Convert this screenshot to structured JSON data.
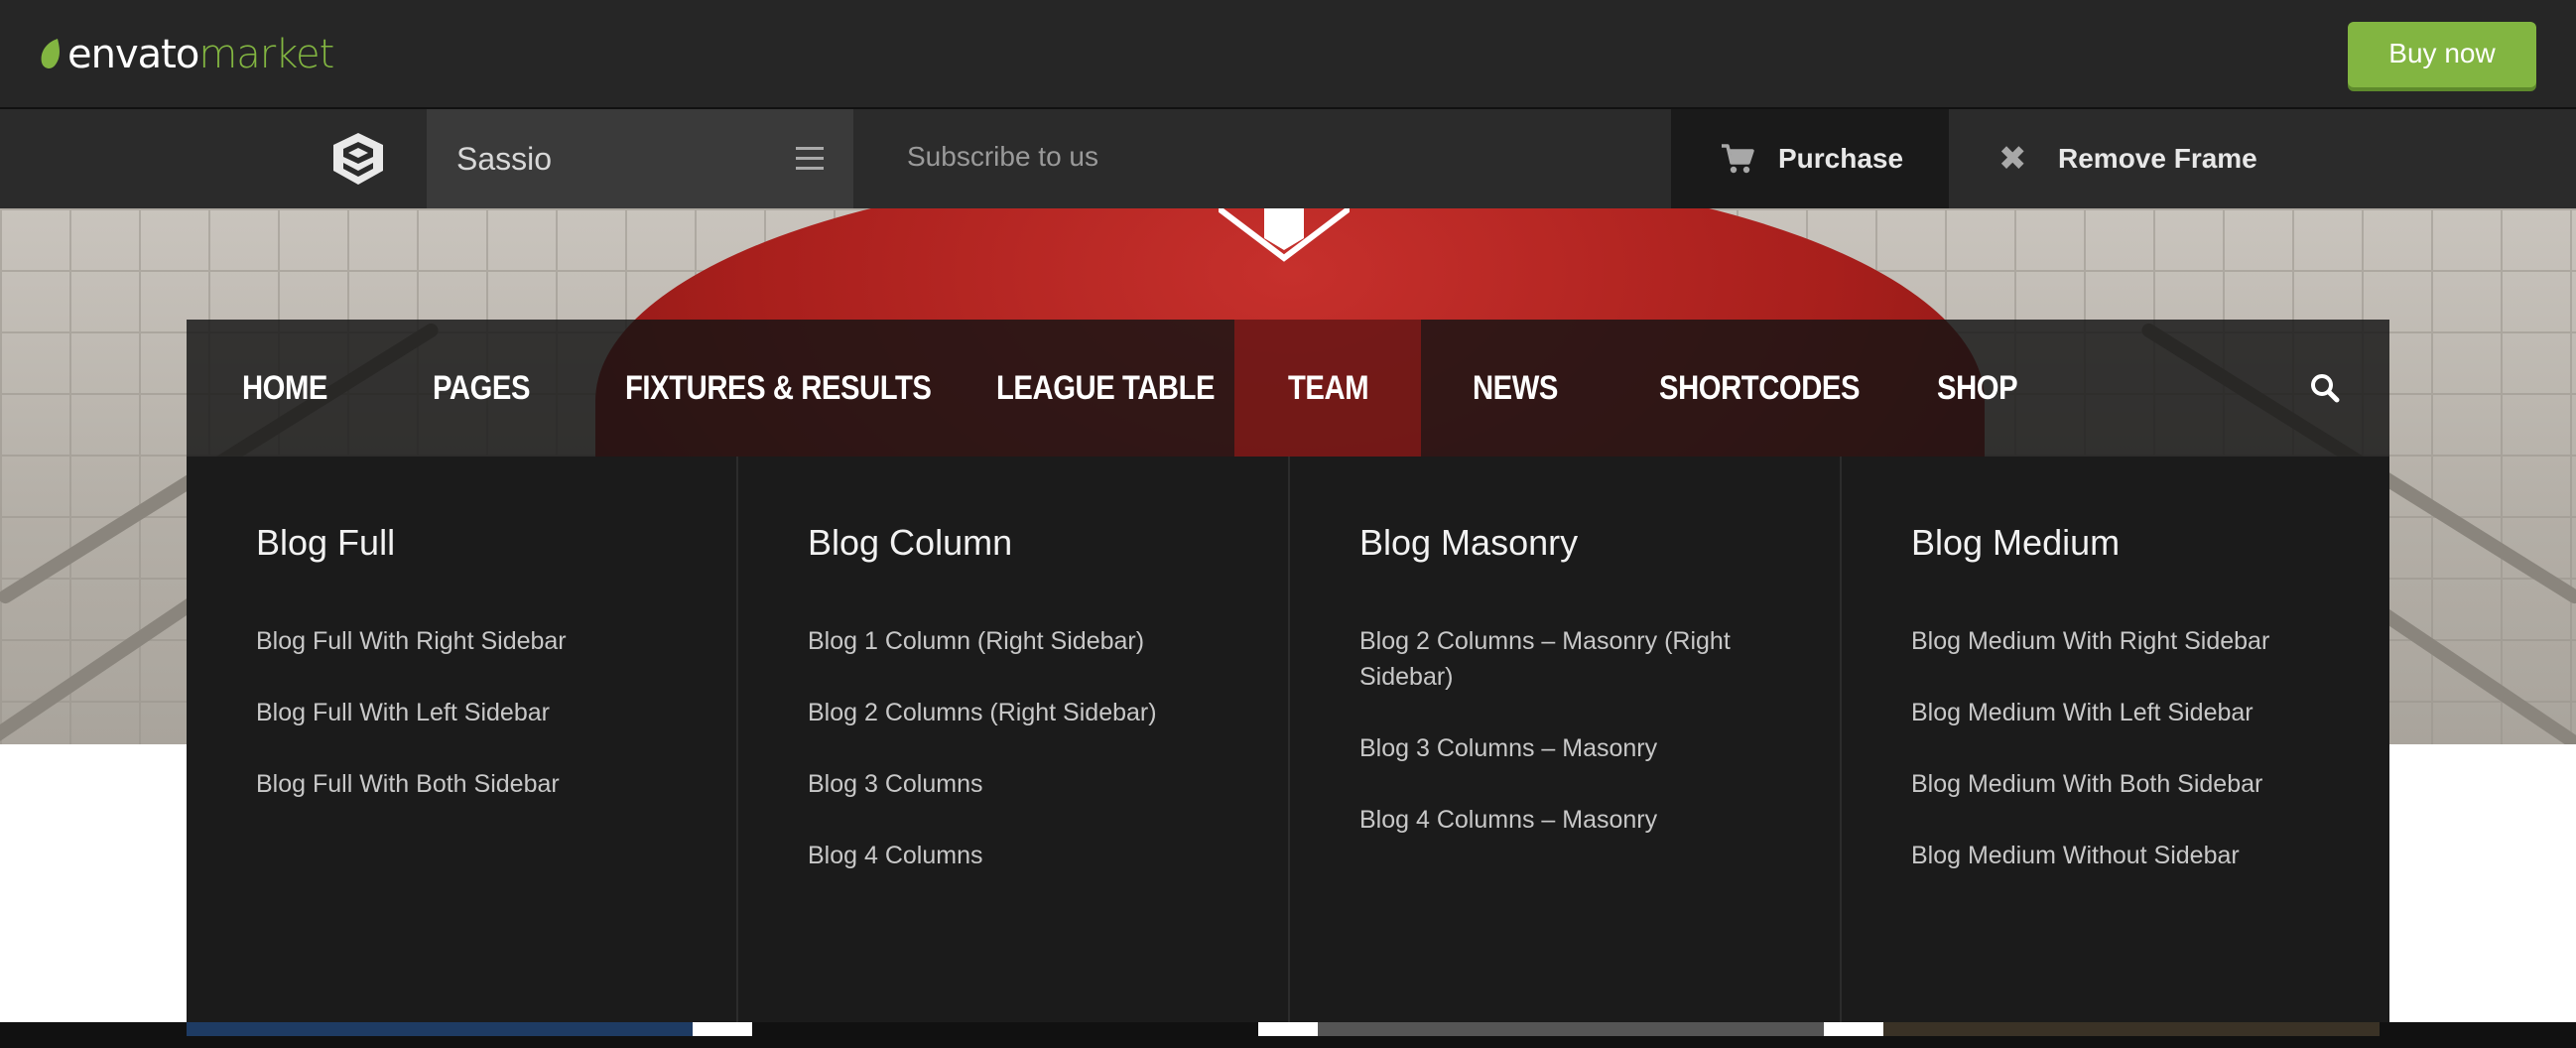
{
  "envato_bar": {
    "logo_part1": "envato",
    "logo_part2": "market",
    "buy_now_label": "Buy now",
    "brand_green": "#82b541"
  },
  "frame_bar": {
    "theme_name": "Sassio",
    "subscribe_label": "Subscribe to us",
    "purchase_label": "Purchase",
    "remove_frame_label": "Remove Frame"
  },
  "main_nav": {
    "items": [
      "HOME",
      "PAGES",
      "FIXTURES & RESULTS",
      "LEAGUE TABLE",
      "TEAM",
      "NEWS",
      "SHORTCODES",
      "SHOP"
    ],
    "active": "TEAM",
    "accent": "#aa1c1a"
  },
  "mega_menu": {
    "columns": [
      {
        "title": "Blog Full",
        "links": [
          "Blog Full With Right Sidebar",
          "Blog Full With Left Sidebar",
          "Blog Full With Both Sidebar"
        ]
      },
      {
        "title": "Blog Column",
        "links": [
          "Blog 1 Column (Right Sidebar)",
          "Blog 2 Columns (Right Sidebar)",
          "Blog 3 Columns",
          "Blog 4 Columns"
        ]
      },
      {
        "title": "Blog Masonry",
        "links": [
          "Blog 2 Columns – Masonry (Right Sidebar)",
          "Blog 3 Columns – Masonry",
          "Blog 4 Columns – Masonry"
        ]
      },
      {
        "title": "Blog Medium",
        "links": [
          "Blog Medium With Right Sidebar",
          "Blog Medium With Left Sidebar",
          "Blog Medium With Both Sidebar",
          "Blog Medium Without Sidebar"
        ]
      }
    ]
  }
}
